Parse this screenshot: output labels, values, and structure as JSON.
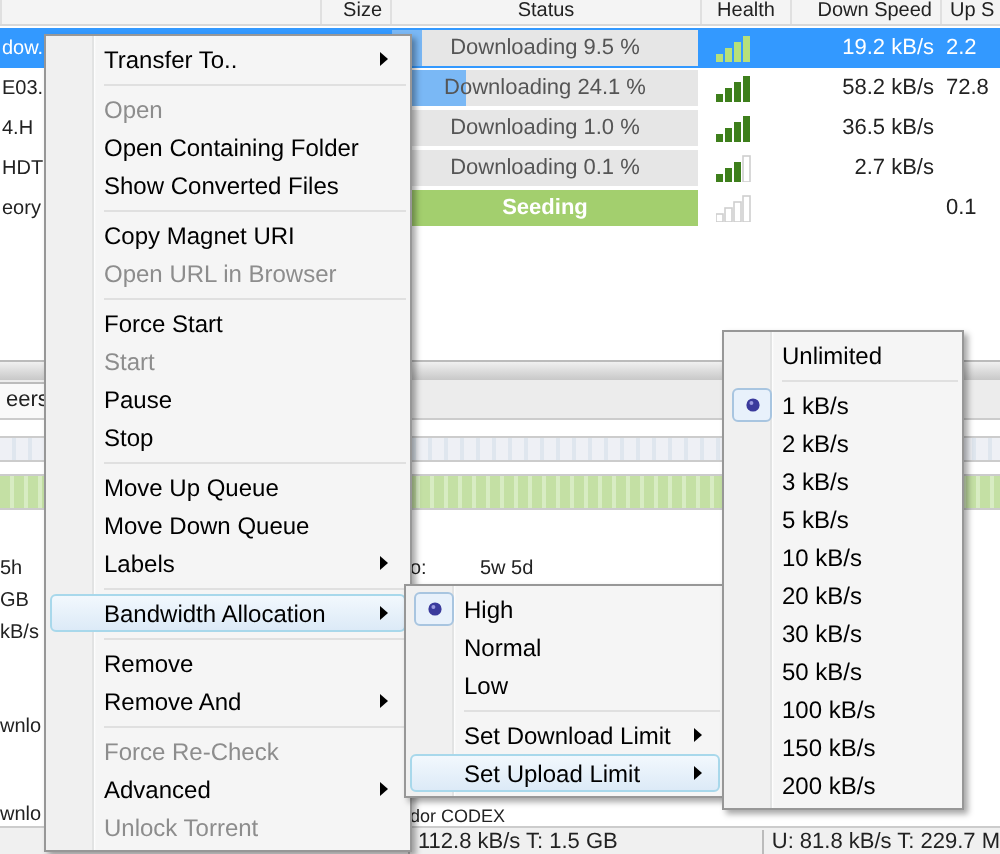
{
  "columns": [
    {
      "label": "Size"
    },
    {
      "label": "Status"
    },
    {
      "label": "Health"
    },
    {
      "label": "Down Speed"
    },
    {
      "label": "Up S"
    }
  ],
  "torrents": [
    {
      "name": "dow.",
      "status": "Downloading 9.5 %",
      "kind": "downloading",
      "level": 0.095,
      "health": {
        "kind": "full"
      },
      "down_speed": "19.2 kB/s",
      "up_speed": "2.2",
      "selected": true
    },
    {
      "name": "E03.",
      "status": "Downloading 24.1 %",
      "kind": "downloading",
      "level": 0.241,
      "health": {
        "kind": "full"
      },
      "down_speed": "58.2 kB/s",
      "up_speed": "72.8",
      "selected": false
    },
    {
      "name": "4.H",
      "status": "Downloading 1.0 %",
      "kind": "downloading",
      "level": 0.01,
      "health": {
        "kind": "full"
      },
      "down_speed": "36.5 kB/s",
      "selected": false
    },
    {
      "name": "HDT",
      "status": "Downloading 0.1 %",
      "kind": "downloading",
      "level": 0.001,
      "health": {
        "kind": "partial"
      },
      "down_speed": "2.7 kB/s",
      "selected": false
    },
    {
      "name": "eory",
      "status": "Seeding",
      "kind": "seeding",
      "level": 1,
      "health": {
        "kind": "empty"
      },
      "up_speed": "0.1",
      "selected": false
    }
  ],
  "detail_tab": {
    "label": "eers"
  },
  "details": [
    [
      {
        "left": "5h",
        "label": "o:",
        "value": "5w 5d"
      },
      {
        "left": "GB"
      },
      {
        "left": "kB/s"
      }
    ],
    [
      {
        "left": "wnlo"
      }
    ],
    [
      {
        "left": "wnlo",
        "label": "dor CODEX"
      }
    ]
  ],
  "status_bar": {
    "download": "112.8 kB/s T: 1.5 GB",
    "upload": "U: 81.8 kB/s T: 229.7 M"
  },
  "context_menu": [
    {
      "kind": "item",
      "label": "Transfer To..",
      "submenu": true,
      "disabled": false,
      "highlighted": false
    },
    {
      "kind": "separator"
    },
    {
      "kind": "item",
      "label": "Open",
      "disabled": true,
      "highlighted": false
    },
    {
      "kind": "item",
      "label": "Open Containing Folder",
      "disabled": false,
      "highlighted": false
    },
    {
      "kind": "item",
      "label": "Show Converted Files",
      "disabled": false,
      "highlighted": false
    },
    {
      "kind": "separator"
    },
    {
      "kind": "item",
      "label": "Copy Magnet URI",
      "disabled": false,
      "highlighted": false
    },
    {
      "kind": "item",
      "label": "Open URL in Browser",
      "disabled": true,
      "highlighted": false
    },
    {
      "kind": "separator"
    },
    {
      "kind": "item",
      "label": "Force Start",
      "disabled": false,
      "highlighted": false
    },
    {
      "kind": "item",
      "label": "Start",
      "disabled": true,
      "highlighted": false
    },
    {
      "kind": "item",
      "label": "Pause",
      "disabled": false,
      "highlighted": false
    },
    {
      "kind": "item",
      "label": "Stop",
      "disabled": false,
      "highlighted": false
    },
    {
      "kind": "separator"
    },
    {
      "kind": "item",
      "label": "Move Up Queue",
      "disabled": false,
      "highlighted": false
    },
    {
      "kind": "item",
      "label": "Move Down Queue",
      "disabled": false,
      "highlighted": false
    },
    {
      "kind": "item",
      "label": "Labels",
      "submenu": true,
      "disabled": false,
      "highlighted": false
    },
    {
      "kind": "separator"
    },
    {
      "kind": "item",
      "label": "Bandwidth Allocation",
      "submenu": true,
      "disabled": false,
      "highlighted": true
    },
    {
      "kind": "separator"
    },
    {
      "kind": "item",
      "label": "Remove",
      "disabled": false,
      "highlighted": false
    },
    {
      "kind": "item",
      "label": "Remove And",
      "submenu": true,
      "disabled": false,
      "highlighted": false
    },
    {
      "kind": "separator"
    },
    {
      "kind": "item",
      "label": "Force Re-Check",
      "disabled": true,
      "highlighted": false
    },
    {
      "kind": "item",
      "label": "Advanced",
      "submenu": true,
      "disabled": false,
      "highlighted": false
    },
    {
      "kind": "item",
      "label": "Unlock Torrent",
      "disabled": true,
      "highlighted": false
    }
  ],
  "bandwidth_menu": [
    {
      "kind": "radio",
      "label": "High",
      "selected": true
    },
    {
      "kind": "radio",
      "label": "Normal",
      "selected": false
    },
    {
      "kind": "radio",
      "label": "Low",
      "selected": false
    },
    {
      "kind": "separator"
    },
    {
      "kind": "item",
      "label": "Set Download Limit",
      "submenu": true,
      "highlighted": false
    },
    {
      "kind": "item",
      "label": "Set Upload Limit",
      "submenu": true,
      "highlighted": true
    }
  ],
  "upload_limit_menu": [
    {
      "kind": "radio",
      "label": "Unlimited",
      "selected": false
    },
    {
      "kind": "separator"
    },
    {
      "kind": "radio",
      "label": "1 kB/s",
      "selected": true
    },
    {
      "kind": "radio",
      "label": "2 kB/s",
      "selected": false
    },
    {
      "kind": "radio",
      "label": "3 kB/s",
      "selected": false
    },
    {
      "kind": "radio",
      "label": "5 kB/s",
      "selected": false
    },
    {
      "kind": "radio",
      "label": "10 kB/s",
      "selected": false
    },
    {
      "kind": "radio",
      "label": "20 kB/s",
      "selected": false
    },
    {
      "kind": "radio",
      "label": "30 kB/s",
      "selected": false
    },
    {
      "kind": "radio",
      "label": "50 kB/s",
      "selected": false
    },
    {
      "kind": "radio",
      "label": "100 kB/s",
      "selected": false
    },
    {
      "kind": "radio",
      "label": "150 kB/s",
      "selected": false
    },
    {
      "kind": "radio",
      "label": "200 kB/s",
      "selected": false
    }
  ]
}
